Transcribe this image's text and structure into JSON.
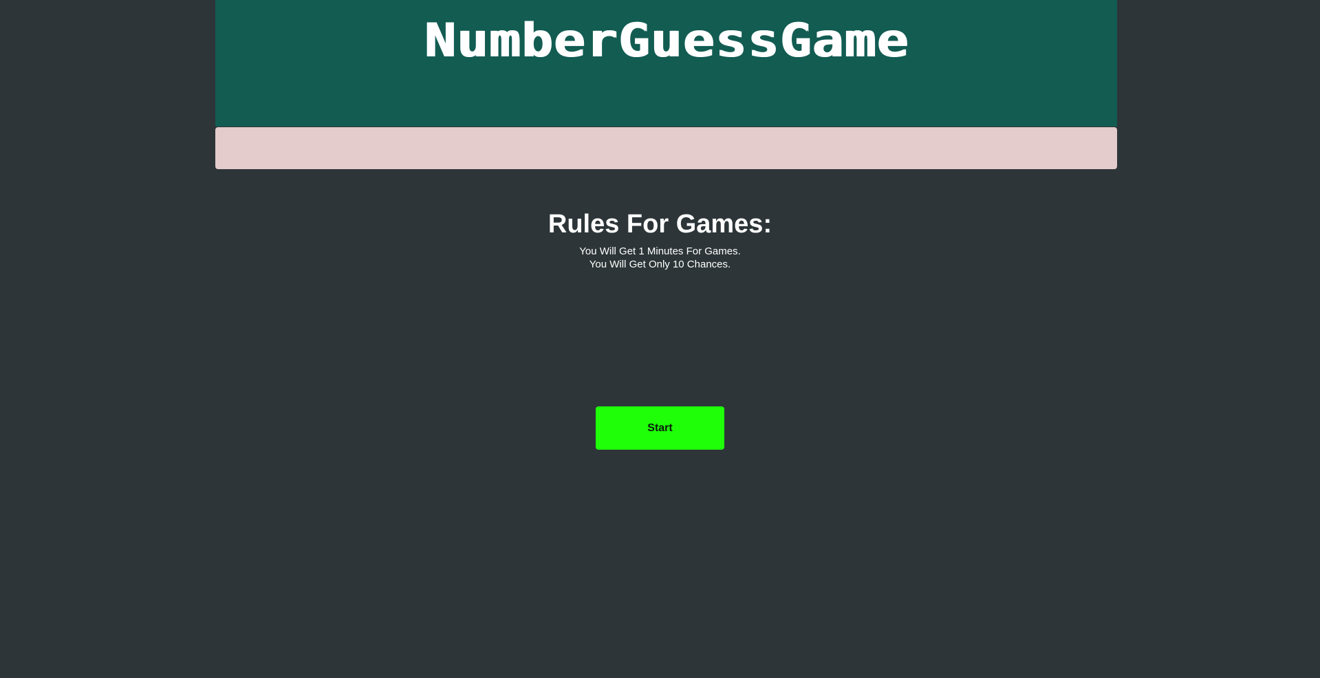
{
  "header": {
    "title": "NumberGuessGame"
  },
  "rules": {
    "heading": "Rules For Games:",
    "lines": [
      "You Will Get 1 Minutes For Games.",
      "You Will Get Only 10 Chances."
    ]
  },
  "actions": {
    "start_label": "Start"
  },
  "colors": {
    "background": "#2d3538",
    "header": "#125c52",
    "banner": "#e4cbcc",
    "start_button": "#1eff08",
    "text": "#ffffff"
  }
}
